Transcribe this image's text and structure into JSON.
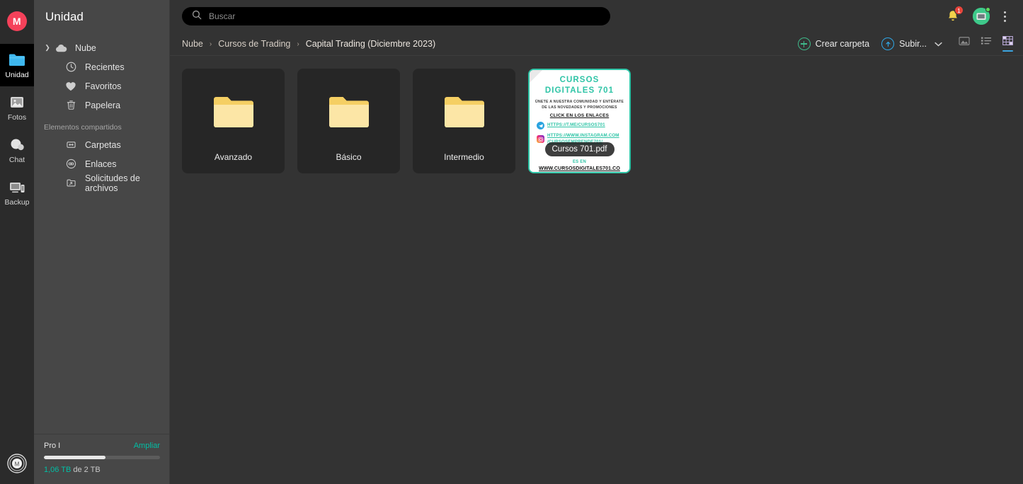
{
  "rail": {
    "logo_letter": "M",
    "items": [
      {
        "label": "Unidad",
        "icon": "drive-folder-icon",
        "active": true
      },
      {
        "label": "Fotos",
        "icon": "photos-image-icon",
        "active": false
      },
      {
        "label": "Chat",
        "icon": "chat-bubble-icon",
        "active": false
      },
      {
        "label": "Backup",
        "icon": "backup-devices-icon",
        "active": false
      }
    ],
    "bottom_icon": "mega-logo-icon"
  },
  "sidebar": {
    "title": "Unidad",
    "items": [
      {
        "label": "Nube",
        "icon": "cloud-icon",
        "expandable": true
      },
      {
        "label": "Recientes",
        "icon": "clock-icon",
        "expandable": false
      },
      {
        "label": "Favoritos",
        "icon": "heart-icon",
        "expandable": false
      },
      {
        "label": "Papelera",
        "icon": "trash-icon",
        "expandable": false
      }
    ],
    "section_label": "Elementos compartidos",
    "shared_items": [
      {
        "label": "Carpetas",
        "icon": "shared-folders-icon"
      },
      {
        "label": "Enlaces",
        "icon": "link-icon"
      },
      {
        "label": "Solicitudes de archivos",
        "icon": "file-request-icon"
      }
    ],
    "storage": {
      "plan": "Pro I",
      "upgrade_label": "Ampliar",
      "percent": 53,
      "used_label": "1,06 TB",
      "total_label": " de 2 TB"
    }
  },
  "topbar": {
    "search_placeholder": "Buscar",
    "search_value": "",
    "search_icon": "search-icon",
    "notifications": {
      "icon": "bell-icon",
      "count": "1"
    },
    "avatar_icon": "account-avatar",
    "menu_icon": "kebab-menu-icon"
  },
  "breadcrumb": {
    "separator": "›",
    "items": [
      "Nube",
      "Cursos de Trading",
      "Capital Trading (Diciembre 2023)"
    ]
  },
  "toolbar": {
    "create_folder_label": "Crear carpeta",
    "create_folder_icon": "plus-circle-icon",
    "upload_label": "Subir...",
    "upload_icon": "upload-circle-icon",
    "upload_chevron_icon": "chevron-down-icon",
    "views": [
      {
        "name": "gallery-view-icon",
        "active": false
      },
      {
        "name": "list-view-icon",
        "active": false
      },
      {
        "name": "grid-view-icon",
        "active": true
      }
    ]
  },
  "files": [
    {
      "name": "Avanzado",
      "type": "folder"
    },
    {
      "name": "Básico",
      "type": "folder"
    },
    {
      "name": "Intermedio",
      "type": "folder"
    },
    {
      "name": "Cursos 701.pdf",
      "type": "pdf",
      "selected": true,
      "thumbnail": {
        "title_line1": "CURSOS",
        "title_line2": "DIGITALES 701",
        "sub_line1": "ÚNETE A NUESTRA COMUNIDAD Y ENTÉRATE",
        "sub_line2": "DE LAS NOVEDADES Y PROMOCIONES",
        "cta": "CLICK EN LOS ENLACES",
        "link_telegram": "HTTPS://T.ME/CURSOS701",
        "link_instagram_1": "HTTPS://WWW.INSTAGRAM.COM",
        "link_instagram_2": "/CURSOSEMPRENDE701/",
        "footer_partial": "ES EN",
        "footer_url": "WWW.CURSOSDIGITALES701.CO"
      }
    }
  ],
  "colors": {
    "accent_teal": "#00bfa5",
    "accent_blue": "#3ca5e0",
    "accent_green": "#3fb98a",
    "badge_red": "#e8453c",
    "folder_yellow": "#fcdf8a",
    "bg_main": "#333333",
    "bg_sidebar": "#474747",
    "bg_rail": "#2b2b2b",
    "bg_card": "#262626"
  }
}
